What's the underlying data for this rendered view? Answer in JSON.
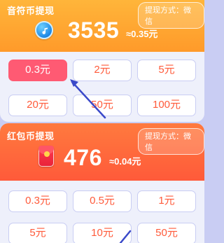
{
  "music": {
    "title": "音符币提现",
    "method": "提现方式：微信",
    "balance": "3535",
    "approx": "≈0.35元",
    "options": [
      "0.3元",
      "2元",
      "5元",
      "20元",
      "50元",
      "100元"
    ],
    "selected_index": 0
  },
  "redbag": {
    "title": "红包币提现",
    "method": "提现方式：微信",
    "balance": "476",
    "approx": "≈0.04元",
    "options": [
      "0.3元",
      "0.5元",
      "1元",
      "5元",
      "10元",
      "50元"
    ]
  },
  "colors": {
    "accent_orange": "#ff9a2a",
    "accent_red": "#ff5a3a",
    "selected_pink": "#ff5a73",
    "arrow_blue": "#3a49c9"
  },
  "icons": [
    "music-coin-icon",
    "red-envelope-icon",
    "pointer-arrow-icon"
  ]
}
